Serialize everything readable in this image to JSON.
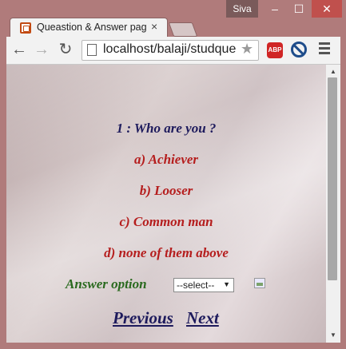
{
  "window": {
    "user": "Siva",
    "minimize": "–",
    "maximize": "☐",
    "close": "✕"
  },
  "tab": {
    "title": "Queastion & Answer page",
    "close": "×"
  },
  "toolbar": {
    "back": "←",
    "forward": "→",
    "reload": "↻",
    "url": "localhost/balaji/studque",
    "star": "★",
    "abp": "ABP"
  },
  "quiz": {
    "question": "1 : Who are you ?",
    "options": [
      "a) Achiever",
      "b) Looser",
      "c) Common man",
      "d) none of them above"
    ],
    "answer_label": "Answer option",
    "select_value": "--select--",
    "select_arrow": "▼",
    "previous": "Previous",
    "next": "Next"
  },
  "scrollbar": {
    "up": "▲",
    "down": "▼"
  }
}
